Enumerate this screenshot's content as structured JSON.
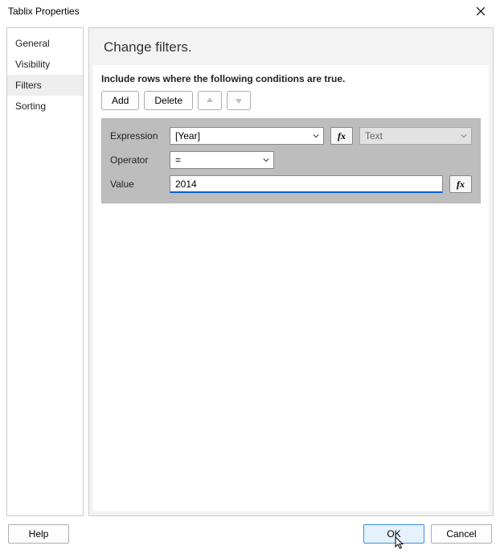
{
  "window": {
    "title": "Tablix Properties"
  },
  "sidebar": {
    "items": [
      {
        "label": "General"
      },
      {
        "label": "Visibility"
      },
      {
        "label": "Filters"
      },
      {
        "label": "Sorting"
      }
    ],
    "selected_index": 2
  },
  "panel": {
    "heading": "Change filters.",
    "instruction": "Include rows where the following conditions are true.",
    "toolbar": {
      "add": "Add",
      "delete": "Delete"
    },
    "rows": {
      "expression_label": "Expression",
      "operator_label": "Operator",
      "value_label": "Value"
    },
    "values": {
      "expression": "[Year]",
      "type": "Text",
      "operator": "=",
      "value": "2014"
    },
    "fx_label": "fx"
  },
  "footer": {
    "help": "Help",
    "ok": "OK",
    "cancel": "Cancel"
  }
}
